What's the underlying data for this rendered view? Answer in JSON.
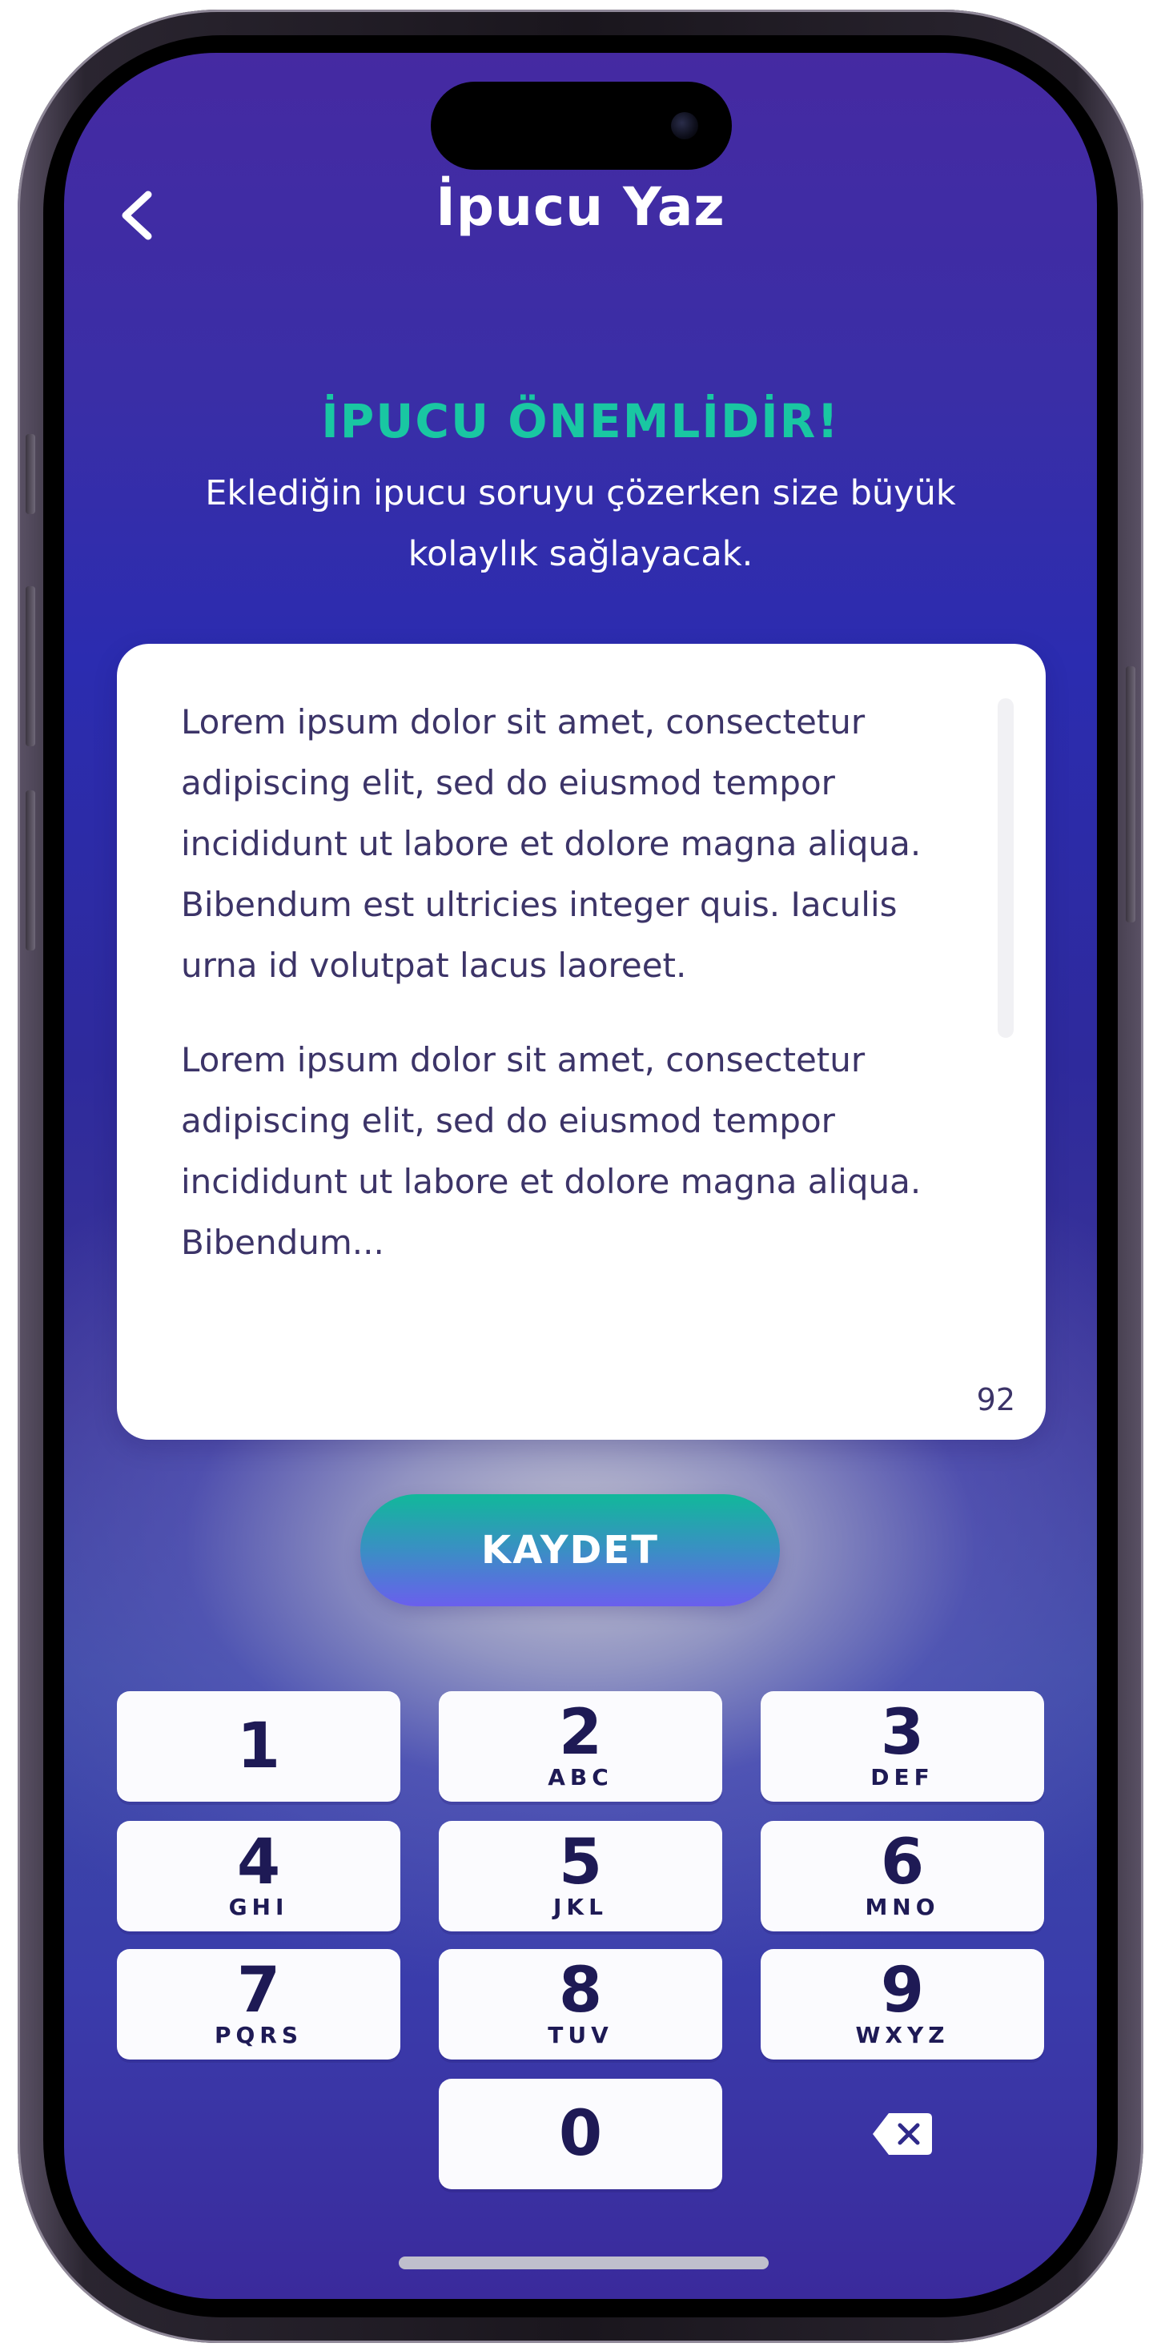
{
  "header": {
    "title": "İpucu Yaz",
    "back_icon": "chevron-left-icon"
  },
  "hint": {
    "title": "İPUCU ÖNEMLİDİR!",
    "subtitle_line1": "Eklediğin ipucu soruyu çözerken size büyük",
    "subtitle_line2": "kolaylık sağlayacak."
  },
  "editor": {
    "paragraph1": "Lorem ipsum dolor sit amet, consectetur adipiscing elit, sed do eiusmod tempor incididunt ut labore et dolore magna aliqua. Bibendum est ultricies integer quis. Iaculis urna id volutpat lacus laoreet.",
    "paragraph2": "Lorem ipsum dolor sit amet, consectetur adipiscing elit, sed do eiusmod tempor incididunt ut labore et dolore magna aliqua. Bibendum...",
    "char_count": "92"
  },
  "save_button": {
    "label": "KAYDET"
  },
  "keypad": {
    "keys": [
      {
        "digit": "1",
        "letters": ""
      },
      {
        "digit": "2",
        "letters": "ABC"
      },
      {
        "digit": "3",
        "letters": "DEF"
      },
      {
        "digit": "4",
        "letters": "GHI"
      },
      {
        "digit": "5",
        "letters": "JKL"
      },
      {
        "digit": "6",
        "letters": "MNO"
      },
      {
        "digit": "7",
        "letters": "PQRS"
      },
      {
        "digit": "8",
        "letters": "TUV"
      },
      {
        "digit": "9",
        "letters": "WXYZ"
      },
      {
        "digit": "0",
        "letters": ""
      }
    ],
    "delete_icon": "backspace-icon"
  },
  "colors": {
    "accent": "#19c7a2",
    "background_top": "#452aa2",
    "text_dark": "#1e1a55"
  }
}
